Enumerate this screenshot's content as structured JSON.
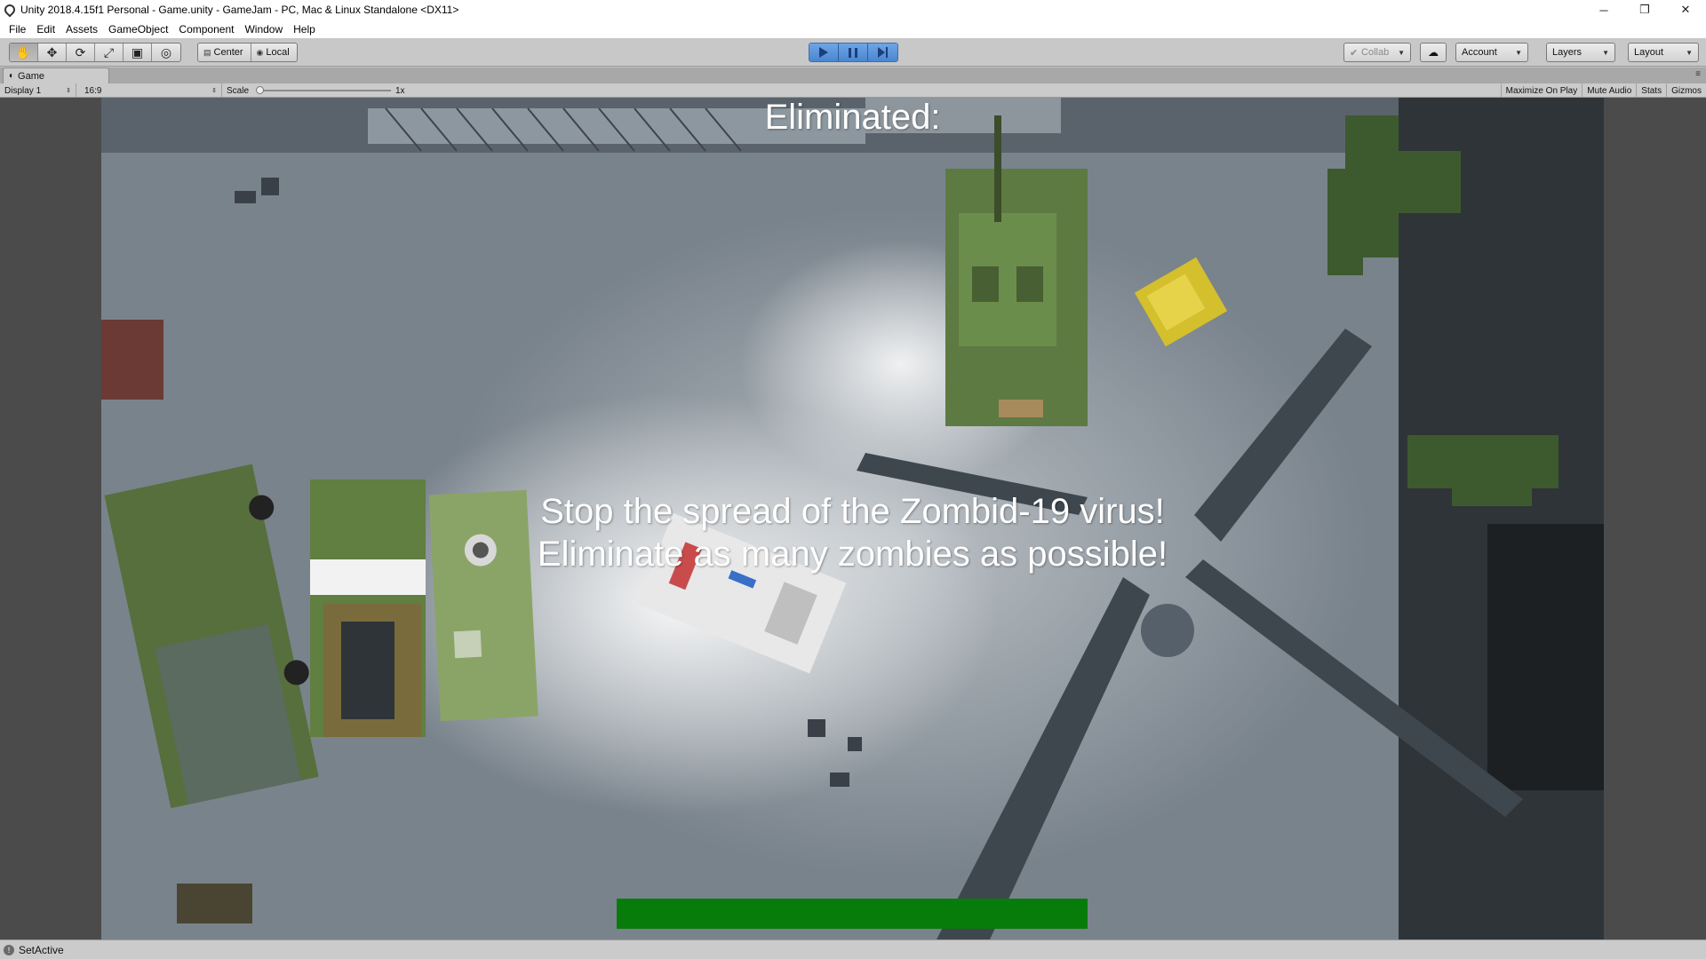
{
  "window": {
    "title": "Unity 2018.4.15f1 Personal - Game.unity - GameJam - PC, Mac & Linux Standalone <DX11>",
    "controls": {
      "minimize": "─",
      "restore": "❐",
      "close": "✕"
    }
  },
  "menu": [
    "File",
    "Edit",
    "Assets",
    "GameObject",
    "Component",
    "Window",
    "Help"
  ],
  "toolbar": {
    "tools": [
      {
        "name": "hand-tool",
        "glyph": "✋"
      },
      {
        "name": "move-tool",
        "glyph": "✥"
      },
      {
        "name": "rotate-tool",
        "glyph": "⟳"
      },
      {
        "name": "scale-tool",
        "glyph": "⤢"
      },
      {
        "name": "rect-tool",
        "glyph": "▣"
      },
      {
        "name": "transform-tool",
        "glyph": "◎"
      }
    ],
    "pivot_label": "Center",
    "space_label": "Local",
    "collab_label": "Collab",
    "account_label": "Account",
    "layers_label": "Layers",
    "layout_label": "Layout",
    "play_accent": "#5b97dd"
  },
  "game_tab": {
    "label": "Game",
    "display": "Display 1",
    "aspect": "16:9",
    "scale_label": "Scale",
    "scale_value": "1x",
    "scale_level": 0,
    "options": [
      "Maximize On Play",
      "Mute Audio",
      "Stats",
      "Gizmos"
    ]
  },
  "hud": {
    "eliminated": "Eliminated:",
    "message_line1": "Stop the spread of the Zombid-19 virus!",
    "message_line2": "Eliminate as many zombies as possible!",
    "health_fraction": 1.0,
    "health_color": "#087c0b"
  },
  "status": {
    "message": "SetActive"
  }
}
